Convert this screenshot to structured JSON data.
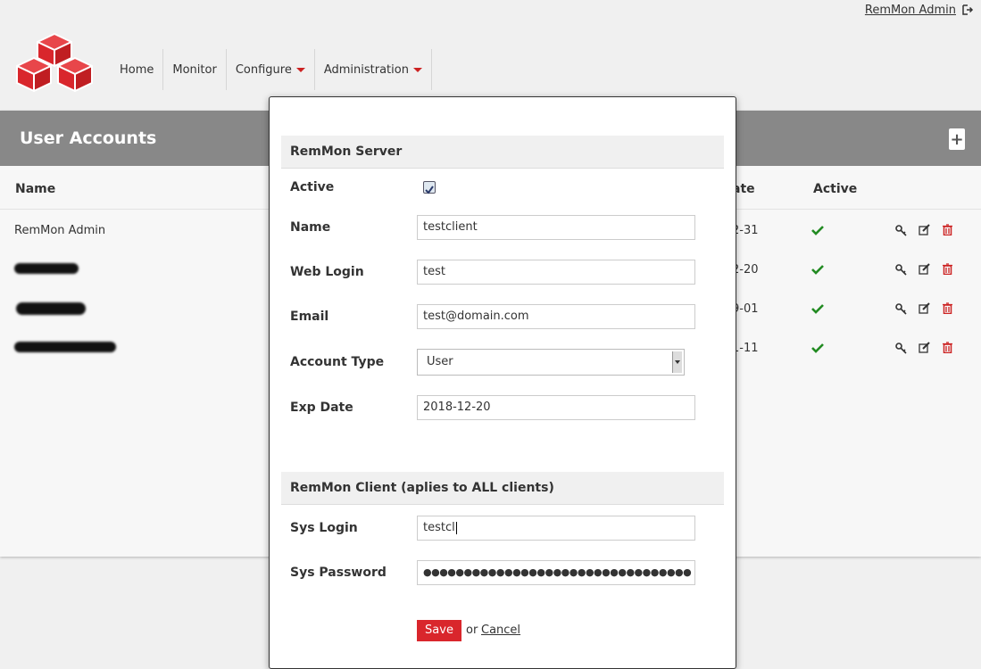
{
  "topbar": {
    "user_link": "RemMon Admin",
    "logout_icon": "logout-icon"
  },
  "nav": {
    "items": [
      {
        "label": "Home"
      },
      {
        "label": "Monitor"
      },
      {
        "label": "Configure"
      },
      {
        "label": "Administration"
      }
    ]
  },
  "page": {
    "title": "User Accounts",
    "add_icon": "plus-icon"
  },
  "table": {
    "headers": {
      "name": "Name",
      "date_fragment": "ate",
      "active": "Active"
    },
    "rows": [
      {
        "name": "RemMon Admin",
        "date_fragment": "2-31"
      },
      {
        "name": "",
        "date_fragment": "2-20"
      },
      {
        "name": "",
        "date_fragment": "9-01"
      },
      {
        "name": "",
        "date_fragment": "1-11"
      }
    ]
  },
  "modal": {
    "server_section": "RemMon Server",
    "client_section": "RemMon Client (aplies to ALL clients)",
    "fields": {
      "active_label": "Active",
      "name_label": "Name",
      "name_value": "testclient",
      "weblogin_label": "Web Login",
      "weblogin_value": "test",
      "email_label": "Email",
      "email_value": "test@domain.com",
      "account_type_label": "Account Type",
      "account_type_value": "User",
      "expdate_label": "Exp Date",
      "expdate_value": "2018-12-20",
      "syslogin_label": "Sys Login",
      "syslogin_value": "testcl",
      "syspassword_label": "Sys Password",
      "syspassword_value": "●●●●●●●●●●●●●●●●●●●●●●●●●●●●●●●●●"
    },
    "save_label": "Save",
    "or_text": "or",
    "cancel_label": "Cancel"
  },
  "colors": {
    "accent": "#d9262c",
    "header_gray": "#888888",
    "check_green": "#228b22"
  }
}
